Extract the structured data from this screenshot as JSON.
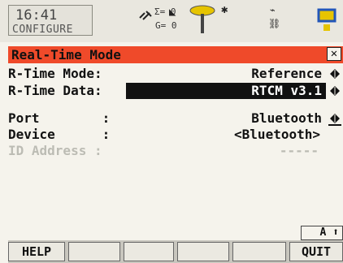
{
  "status": {
    "time": "16:41",
    "mode": "CONFIGURE",
    "sat_sum": "Σ= 0",
    "sat_g": "G= 0"
  },
  "title": "Real-Time Mode",
  "fields": {
    "rtime_mode": {
      "label": "R-Time Mode:",
      "value": "Reference"
    },
    "rtime_data": {
      "label": "R-Time Data:",
      "value": "RTCM v3.1"
    },
    "port": {
      "label": "Port        :",
      "value": "Bluetooth"
    },
    "device": {
      "label": "Device      :",
      "value": "<Bluetooth>"
    },
    "id_address": {
      "label": "ID Address :",
      "value": "-----"
    }
  },
  "caps_indicator": "A ⬆",
  "fkeys": {
    "f1": "HELP",
    "f6": "QUIT"
  },
  "colors": {
    "title_bar": "#ef4a2a",
    "background": "#f5f3ec"
  }
}
